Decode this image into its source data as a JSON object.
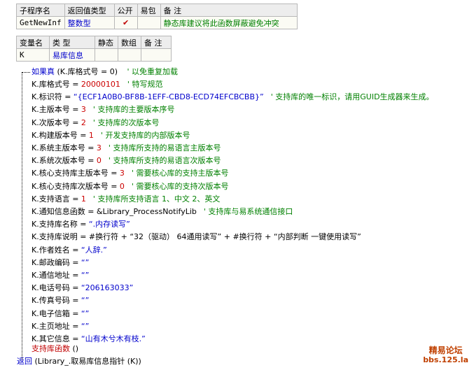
{
  "sub_table": {
    "headers": [
      "子程序名",
      "返回值类型",
      "公开",
      "易包",
      "备 注"
    ],
    "row": {
      "name": "GetNewInf",
      "return_type": "整数型",
      "public_check": "✔",
      "package": "",
      "remark": "静态库建议将此函数屏蔽避免冲突"
    }
  },
  "var_table": {
    "headers": [
      "变量名",
      "类 型",
      "静态",
      "数组",
      "备 注"
    ],
    "row": {
      "name": "K",
      "type": "易库信息",
      "static": "",
      "array": "",
      "remark": ""
    }
  },
  "code": {
    "if_line": {
      "kw": "如果真",
      "cond": "(K.库格式号 = 0)",
      "comment": "' 以免重复加载"
    },
    "lines": [
      {
        "code": "K.库格式号 = ",
        "val": "20000101",
        "val_kind": "num",
        "comment": "' 特写规范"
      },
      {
        "code": "K.标识符 = ",
        "val": "“{ECF1A0B0-BF8B-1EFF-CBD8-ECD74EFCBCBB}”",
        "val_kind": "str",
        "comment": "' 支持库的唯一标识，请用GUID生成器来生成。"
      },
      {
        "code": "K.主版本号 = ",
        "val": "3",
        "val_kind": "num",
        "comment": "' 支持库的主要版本序号"
      },
      {
        "code": "K.次版本号 = ",
        "val": "2",
        "val_kind": "num",
        "comment": "' 支持库的次版本号"
      },
      {
        "code": "K.构建版本号 = ",
        "val": "1",
        "val_kind": "num",
        "comment": "' 开发支持库的内部版本号"
      },
      {
        "code": "K.系统主版本号 = ",
        "val": "3",
        "val_kind": "num",
        "comment": "' 支持库所支持的易语言主版本号"
      },
      {
        "code": "K.系统次版本号 = ",
        "val": "0",
        "val_kind": "num",
        "comment": "' 支持库所支持的易语言次版本号"
      },
      {
        "code": "K.核心支持库主版本号 = ",
        "val": "3",
        "val_kind": "num",
        "comment": "' 需要核心库的支持主版本号"
      },
      {
        "code": "K.核心支持库次版本号 = ",
        "val": "0",
        "val_kind": "num",
        "comment": "' 需要核心库的支持次版本号"
      },
      {
        "code": "K.支持语言 = ",
        "val": "1",
        "val_kind": "num",
        "comment": "' 支持库所支持语言 1、中文 2、英文"
      },
      {
        "code": "K.通知信息函数 = ",
        "val": "&Library_ProcessNotifyLib",
        "val_kind": "plain",
        "comment": "' 支持库与易系统通信接口"
      },
      {
        "code": "K.支持库名称 = ",
        "val": "“.内存读写”",
        "val_kind": "str",
        "comment": ""
      },
      {
        "code": "K.支持库说明 = ",
        "val": "#换行符 + “32（驱动） 64通用读写” + #换行符 + “内部判断 一键使用读写”",
        "val_kind": "plain",
        "comment": ""
      },
      {
        "code": "K.作者姓名 = ",
        "val": "“人辞.”",
        "val_kind": "str",
        "comment": ""
      },
      {
        "code": "K.邮政编码 = ",
        "val": "“”",
        "val_kind": "str",
        "comment": ""
      },
      {
        "code": "K.通信地址 = ",
        "val": "“”",
        "val_kind": "str",
        "comment": ""
      },
      {
        "code": "K.电话号码 = ",
        "val": "“206163033”",
        "val_kind": "str",
        "comment": ""
      },
      {
        "code": "K.传真号码 = ",
        "val": "“”",
        "val_kind": "str",
        "comment": ""
      },
      {
        "code": "K.电子信箱 = ",
        "val": "“”",
        "val_kind": "str",
        "comment": ""
      },
      {
        "code": "K.主页地址 = ",
        "val": "“”",
        "val_kind": "str",
        "comment": ""
      },
      {
        "code": "K.其它信息 = ",
        "val": "“山有木兮木有枝.”",
        "val_kind": "str",
        "comment": ""
      }
    ],
    "call_line": {
      "fn": "支持库函数",
      "args": "()"
    },
    "return_line": {
      "kw": "返回",
      "args": "(Library_.取易库信息指针 (K))"
    }
  },
  "watermark": {
    "line1": "精易论坛",
    "line2": "bbs.125.la"
  }
}
